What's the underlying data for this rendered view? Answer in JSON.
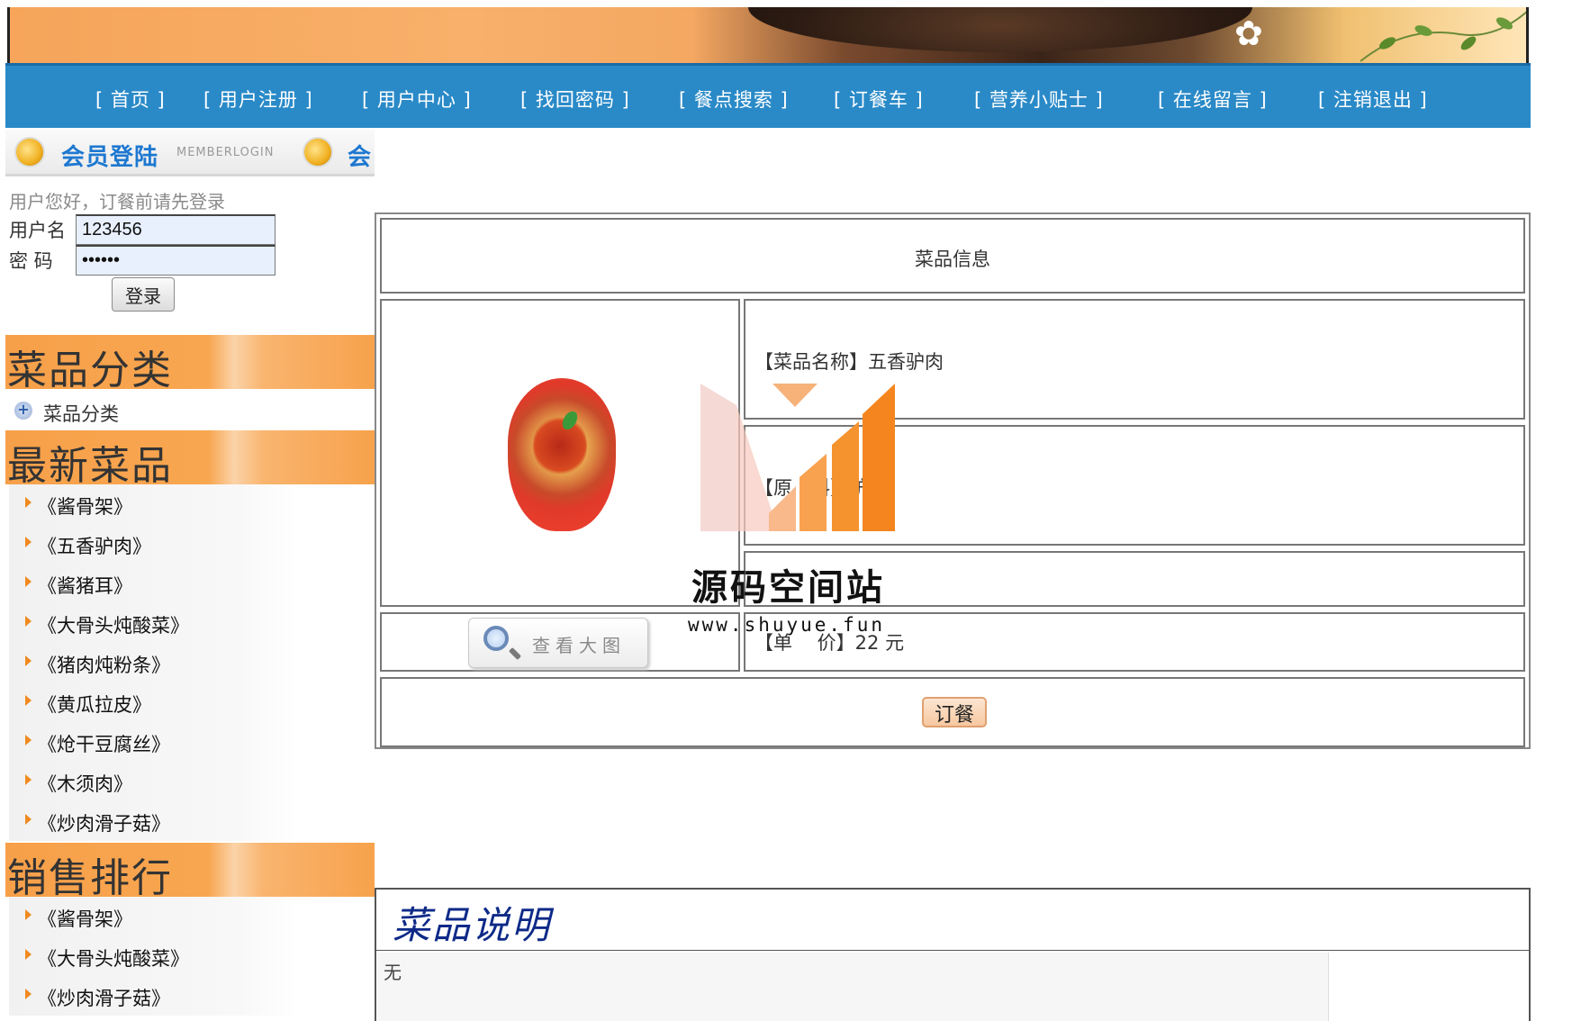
{
  "nav": {
    "items": [
      "[ 首页 ]",
      "[ 用户注册 ]",
      "[ 用户中心 ]",
      "[ 找回密码 ]",
      "[ 餐点搜索 ]",
      "[ 订餐车 ]",
      "[ 营养小贴士 ]",
      "[ 在线留言 ]",
      "[ 注销退出 ]"
    ]
  },
  "login": {
    "header_title": "会员登陆",
    "header_sub": "MEMBERLOGIN",
    "header_title2": "会",
    "hint": "用户您好，订餐前请先登录",
    "username_label": "用户名",
    "username_value": "123456",
    "password_label": "密 码",
    "password_value": "••••••",
    "login_button": "登录"
  },
  "sidebar": {
    "category_title": "菜品分类",
    "category_item": "菜品分类",
    "latest_title": "最新菜品",
    "latest_items": [
      "《酱骨架》",
      "《五香驴肉》",
      "《酱猪耳》",
      "《大骨头炖酸菜》",
      "《猪肉炖粉条》",
      "《黄瓜拉皮》",
      "《炝干豆腐丝》",
      "《木须肉》",
      "《炒肉滑子菇》"
    ],
    "sales_title": "销售排行",
    "sales_items": [
      "《酱骨架》",
      "《大骨头炖酸菜》",
      "《炒肉滑子菇》"
    ]
  },
  "dish": {
    "header": "菜品信息",
    "name_line": "【菜品名称】五香驴肉",
    "material_line": "【原　料】驴肉",
    "price_line": "【单　 价】22 元",
    "view_big": "查看大图",
    "order_button": "订餐"
  },
  "description": {
    "title": "菜品说明",
    "body": "无"
  },
  "watermark": {
    "title": "源码空间站",
    "url": "www.shuyue.fun"
  },
  "colors": {
    "nav_bg": "#2a8ac8",
    "section_orange": "#f7a04a",
    "desc_title": "#0e2a88",
    "watermark_orange": "#f5861f"
  }
}
